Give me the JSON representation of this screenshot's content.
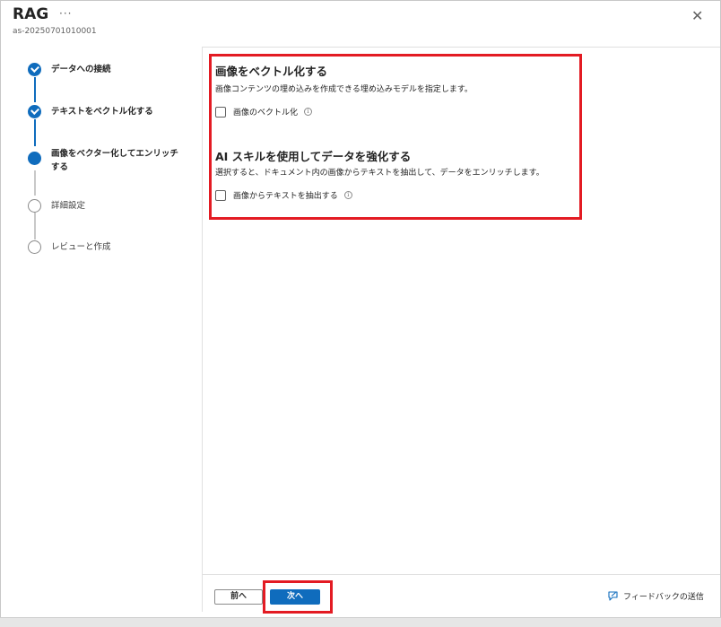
{
  "header": {
    "title": "RAG",
    "more_label": "···",
    "subtitle": "as-20250701010001",
    "close_label": "✕"
  },
  "steps": [
    {
      "label": "データへの接続",
      "status": "done"
    },
    {
      "label": "テキストをベクトル化する",
      "status": "done"
    },
    {
      "label": "画像をベクター化してエンリッチする",
      "status": "current"
    },
    {
      "label": "詳細設定",
      "status": "todo"
    },
    {
      "label": "レビューと作成",
      "status": "todo"
    }
  ],
  "sections": {
    "vectorize": {
      "title": "画像をベクトル化する",
      "description": "画像コンテンツの埋め込みを作成できる埋め込みモデルを指定します。",
      "checkbox_label": "画像のベクトル化",
      "checked": false
    },
    "ai_skill": {
      "title": "AI スキルを使用してデータを強化する",
      "description": "選択すると、ドキュメント内の画像からテキストを抽出して、データをエンリッチします。",
      "checkbox_label": "画像からテキストを抽出する",
      "checked": false
    }
  },
  "footer": {
    "prev_label": "前へ",
    "next_label": "次へ",
    "feedback_label": "フィードバックの送信"
  },
  "info_glyph": "i",
  "colors": {
    "accent": "#0f6cbd",
    "highlight": "#e31b23"
  }
}
